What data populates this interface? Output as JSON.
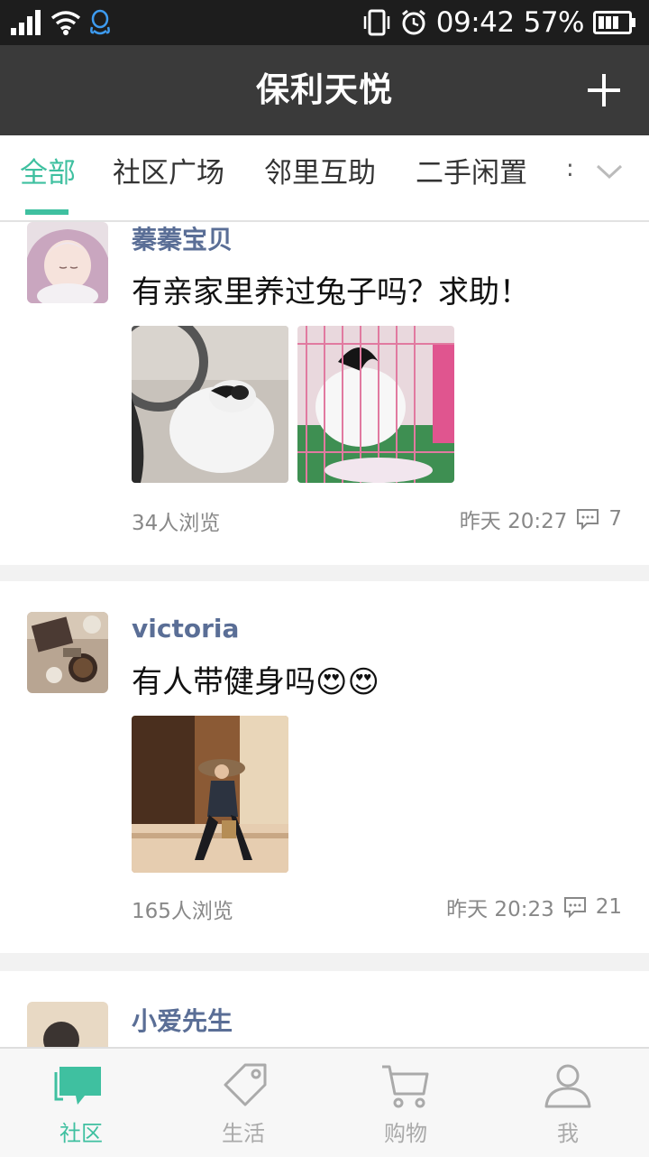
{
  "status_bar": {
    "time": "09:42",
    "battery": "57%",
    "icons": [
      "signal-icon",
      "wifi-icon",
      "qq-icon",
      "vibrate-icon",
      "alarm-icon",
      "battery-icon"
    ]
  },
  "header": {
    "title": "保利天悦",
    "add_icon": "plus-icon"
  },
  "tabs": {
    "items": [
      {
        "label": "全部",
        "active": true
      },
      {
        "label": "社区广场",
        "active": false
      },
      {
        "label": "邻里互助",
        "active": false
      },
      {
        "label": "二手闲置",
        "active": false
      }
    ],
    "overflow": ":",
    "expand_icon": "chevron-down-icon"
  },
  "posts": [
    {
      "username": "蓁蓁宝贝",
      "text": "有亲家里养过兔子吗？求助！",
      "views": "34人浏览",
      "time": "昨天 20:27",
      "comments": "7",
      "images": [
        "rabbit-photo",
        "rabbit-cage-photo"
      ]
    },
    {
      "username": "victoria",
      "text": "有人带健身吗😍😍",
      "views": "165人浏览",
      "time": "昨天 20:23",
      "comments": "21",
      "images": [
        "woman-photo"
      ]
    },
    {
      "username": "小爱先生"
    }
  ],
  "bottom_nav": {
    "items": [
      {
        "label": "社区",
        "icon": "chat-bubble-icon",
        "active": true
      },
      {
        "label": "生活",
        "icon": "tag-icon",
        "active": false
      },
      {
        "label": "购物",
        "icon": "cart-icon",
        "active": false
      },
      {
        "label": "我",
        "icon": "person-icon",
        "active": false
      }
    ]
  },
  "colors": {
    "accent": "#3fc0a0",
    "header_bg": "#3a3a3a",
    "username": "#5a6e96"
  }
}
